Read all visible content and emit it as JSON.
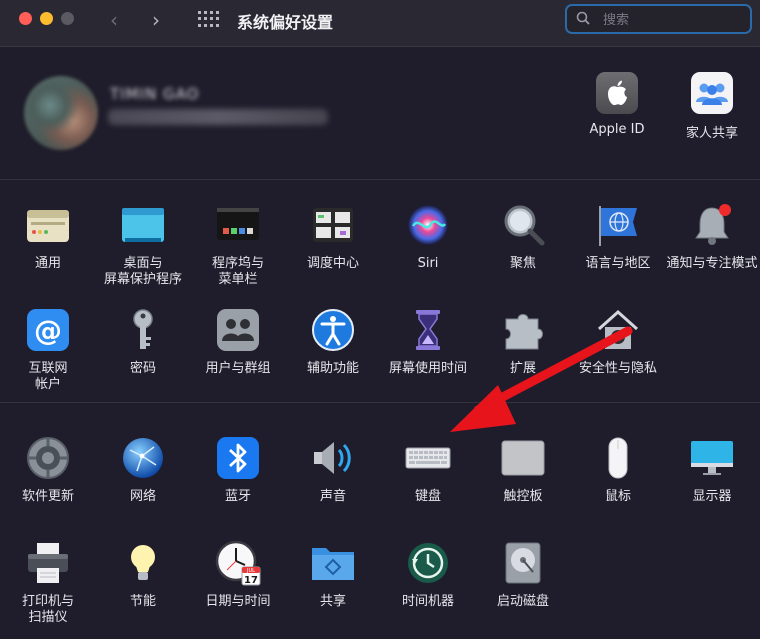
{
  "window": {
    "title": "系统偏好设置",
    "search_placeholder": "搜索"
  },
  "account": {
    "name": "TIMIN GAO",
    "items": [
      {
        "label": "Apple ID",
        "icon": "apple-icon"
      },
      {
        "label": "家人共享",
        "icon": "family-sharing-icon"
      }
    ]
  },
  "section1": [
    {
      "label": "通用",
      "icon": "general-icon"
    },
    {
      "label": "桌面与\n屏幕保护程序",
      "icon": "desktop-screensaver-icon"
    },
    {
      "label": "程序坞与\n菜单栏",
      "icon": "dock-menubar-icon"
    },
    {
      "label": "调度中心",
      "icon": "mission-control-icon"
    },
    {
      "label": "Siri",
      "icon": "siri-icon"
    },
    {
      "label": "聚焦",
      "icon": "spotlight-icon"
    },
    {
      "label": "语言与地区",
      "icon": "language-region-icon"
    },
    {
      "label": "通知与专注模式",
      "icon": "notifications-icon"
    },
    {
      "label": "互联网\n帐户",
      "icon": "internet-accounts-icon"
    },
    {
      "label": "密码",
      "icon": "passwords-icon"
    },
    {
      "label": "用户与群组",
      "icon": "users-groups-icon"
    },
    {
      "label": "辅助功能",
      "icon": "accessibility-icon"
    },
    {
      "label": "屏幕使用时间",
      "icon": "screen-time-icon"
    },
    {
      "label": "扩展",
      "icon": "extensions-icon"
    },
    {
      "label": "安全性与隐私",
      "icon": "security-privacy-icon"
    }
  ],
  "section2": [
    {
      "label": "软件更新",
      "icon": "software-update-icon"
    },
    {
      "label": "网络",
      "icon": "network-icon"
    },
    {
      "label": "蓝牙",
      "icon": "bluetooth-icon"
    },
    {
      "label": "声音",
      "icon": "sound-icon"
    },
    {
      "label": "键盘",
      "icon": "keyboard-icon"
    },
    {
      "label": "触控板",
      "icon": "trackpad-icon"
    },
    {
      "label": "鼠标",
      "icon": "mouse-icon"
    },
    {
      "label": "显示器",
      "icon": "displays-icon"
    },
    {
      "label": "打印机与\n扫描仪",
      "icon": "printers-scanners-icon"
    },
    {
      "label": "节能",
      "icon": "energy-saver-icon"
    },
    {
      "label": "日期与时间",
      "icon": "date-time-icon"
    },
    {
      "label": "共享",
      "icon": "sharing-icon"
    },
    {
      "label": "时间机器",
      "icon": "time-machine-icon"
    },
    {
      "label": "启动磁盘",
      "icon": "startup-disk-icon"
    }
  ],
  "calendar_badge": {
    "month": "JUL",
    "day": "17"
  },
  "colors": {
    "background": "#1f1d2b",
    "annotation_arrow": "#e8141c",
    "search_focus": "#2a6aa8"
  }
}
